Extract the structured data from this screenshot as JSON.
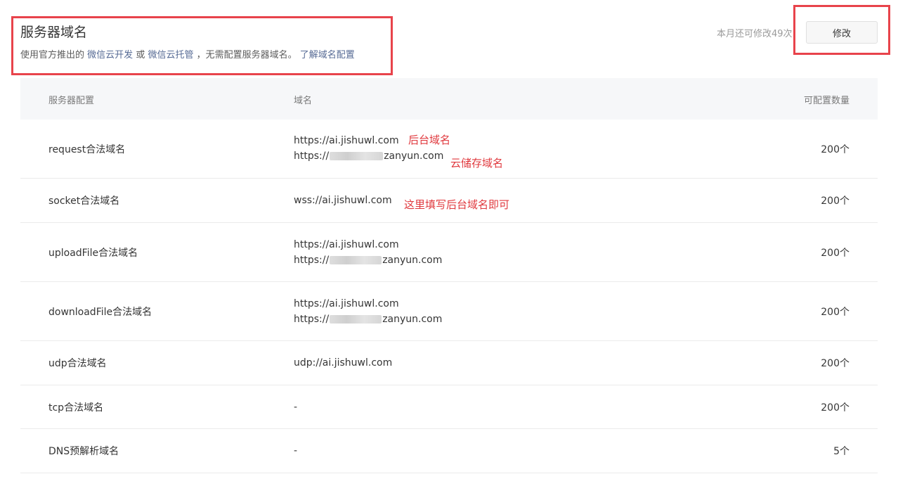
{
  "header": {
    "title": "服务器域名",
    "desc_prefix": "使用官方推出的",
    "link_cloud_dev": "微信云开发",
    "desc_or": "或",
    "link_cloud_host": "微信云托管",
    "desc_suffix": "，无需配置服务器域名。",
    "link_learn": "了解域名配置",
    "quota_text": "本月还可修改49次",
    "modify_label": "修改"
  },
  "table": {
    "col_config": "服务器配置",
    "col_domain": "域名",
    "col_count": "可配置数量",
    "rows": [
      {
        "name": "request合法域名",
        "line1": "https://ai.jishuwl.com",
        "line2_prefix": "https://",
        "line2_suffix": "zanyun.com",
        "count": "200个"
      },
      {
        "name": "socket合法域名",
        "line1": "wss://ai.jishuwl.com",
        "count": "200个"
      },
      {
        "name": "uploadFile合法域名",
        "line1": "https://ai.jishuwl.com",
        "line2_prefix": "https://",
        "line2_suffix": "zanyun.com",
        "count": "200个"
      },
      {
        "name": "downloadFile合法域名",
        "line1": "https://ai.jishuwl.com",
        "line2_prefix": "https://",
        "line2_suffix": "zanyun.com",
        "count": "200个"
      },
      {
        "name": "udp合法域名",
        "line1": "udp://ai.jishuwl.com",
        "count": "200个"
      },
      {
        "name": "tcp合法域名",
        "line1": "-",
        "count": "200个"
      },
      {
        "name": "DNS预解析域名",
        "line1": "-",
        "count": "5个"
      }
    ]
  },
  "annotations": {
    "backend_domain": "后台域名",
    "storage_domain": "云储存域名",
    "socket_hint": "这里填写后台域名即可"
  },
  "colors": {
    "link": "#576b95",
    "annotation": "#e0393e",
    "highlight_box": "#e8434b"
  }
}
